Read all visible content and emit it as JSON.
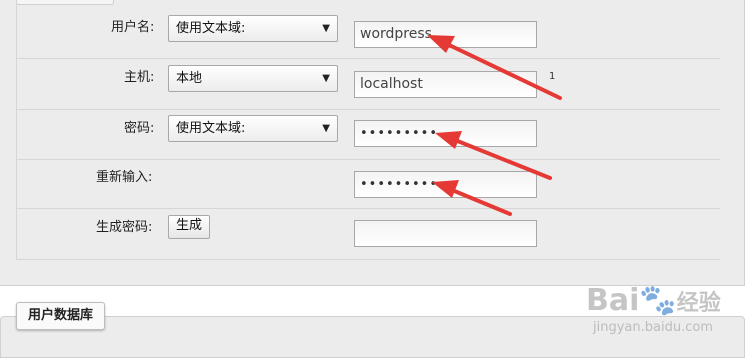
{
  "form": {
    "username": {
      "label": "用户名:",
      "select": "使用文本域:",
      "value": "wordpress"
    },
    "host": {
      "label": "主机:",
      "select": "本地",
      "value": "localhost",
      "note": "1"
    },
    "password": {
      "label": "密码:",
      "select": "使用文本域:",
      "value": "•••••••••"
    },
    "retype": {
      "label": "重新输入:",
      "value": "•••••••••"
    },
    "generate": {
      "label": "生成密码:",
      "button": "生成",
      "value": ""
    }
  },
  "bottom": {
    "tab_label": "用户数据库"
  },
  "watermark": {
    "brand": "Bai",
    "brand2": "经验",
    "url": "jingyan.baidu.com"
  },
  "colors": {
    "arrow": "#e53935",
    "panel": "#ececec"
  }
}
